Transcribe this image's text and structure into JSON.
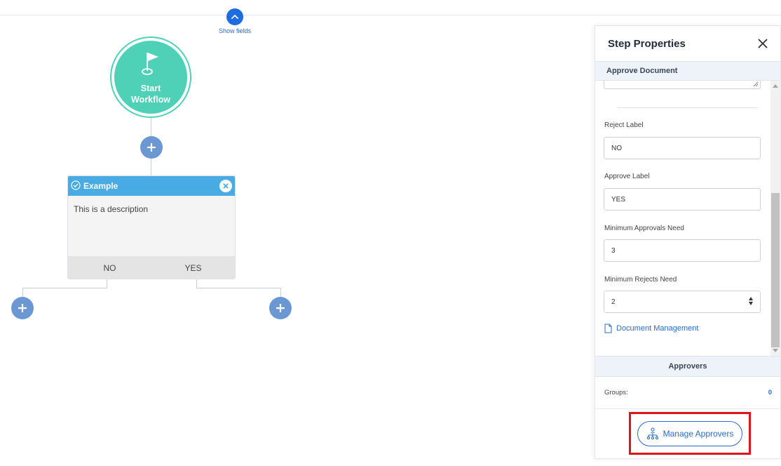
{
  "toolbar": {
    "show_fields_label": "Show fields"
  },
  "workflow": {
    "start_label": "Start Workflow",
    "step": {
      "title": "Example",
      "description": "This is a description",
      "outcomes": [
        "NO",
        "YES"
      ]
    }
  },
  "panel": {
    "title": "Step Properties",
    "section": "Approve Document",
    "fields": {
      "reject_label": {
        "label": "Reject Label",
        "value": "NO"
      },
      "approve_label": {
        "label": "Approve Label",
        "value": "YES"
      },
      "min_approvals": {
        "label": "Minimum Approvals Need",
        "value": "3"
      },
      "min_rejects": {
        "label": "Minimum Rejects Need",
        "value": "2"
      }
    },
    "document_link": "Document Management",
    "approvers": {
      "header": "Approvers",
      "groups_label": "Groups:",
      "groups_count": "0",
      "manage_button": "Manage Approvers"
    }
  },
  "colors": {
    "accent": "#2d6cc6",
    "start_node": "#4fd1b8",
    "step_header": "#49abe3",
    "add_button": "#6b97d2",
    "highlight": "#e1141d"
  }
}
